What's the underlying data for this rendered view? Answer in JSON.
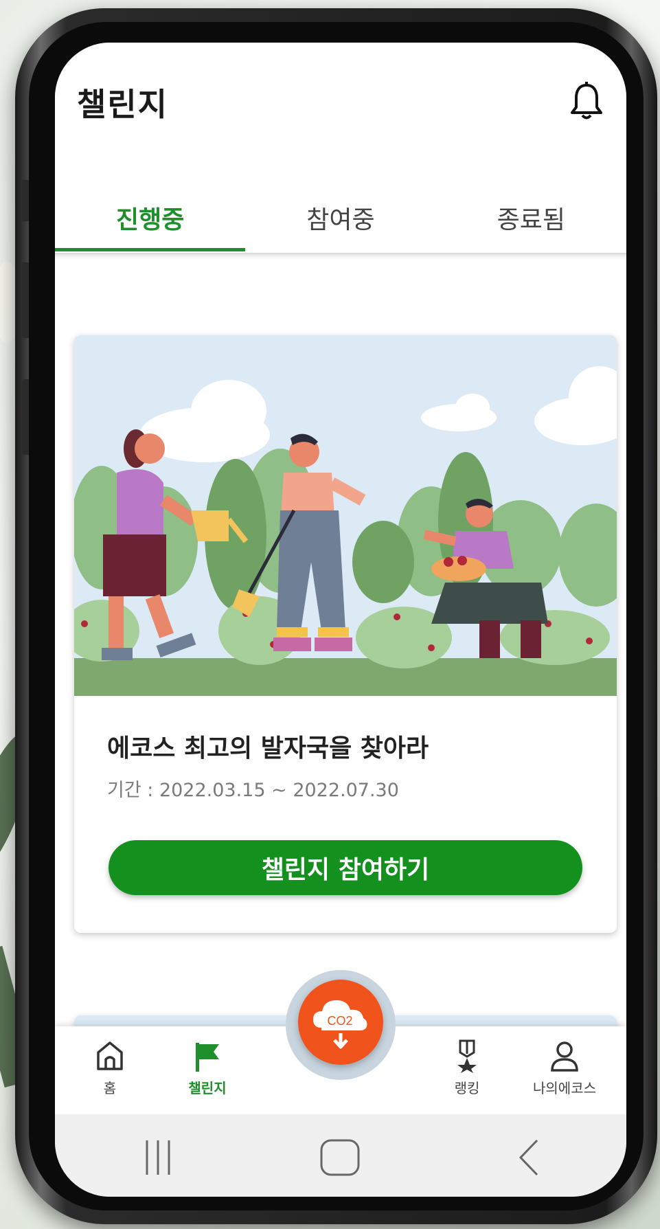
{
  "header": {
    "title": "챌린지",
    "notification_icon": "bell-icon"
  },
  "tabs": [
    {
      "label": "진행중",
      "active": true
    },
    {
      "label": "참여중",
      "active": false
    },
    {
      "label": "종료됨",
      "active": false
    }
  ],
  "challenge_card": {
    "title": "에코스 최고의 발자국을 찾아라",
    "period": "기간 : 2022.03.15 ~ 2022.07.30",
    "join_label": "챌린지 참여하기"
  },
  "bottom_nav": {
    "items": [
      {
        "label": "홈",
        "icon": "home-icon",
        "active": false
      },
      {
        "label": "챌린지",
        "icon": "flag-icon",
        "active": true
      },
      {
        "label": "랭킹",
        "icon": "medal-icon",
        "active": false
      },
      {
        "label": "나의에코스",
        "icon": "user-icon",
        "active": false
      }
    ],
    "center_button": {
      "label": "CO2",
      "icon": "co2-cloud-icon"
    }
  },
  "system_nav": {
    "recent": "recent-apps-icon",
    "home": "home-square-icon",
    "back": "back-icon"
  },
  "colors": {
    "accent": "#1f8f2c",
    "button": "#14901f",
    "co2": "#f0541c",
    "sky": "#dceaf5"
  }
}
